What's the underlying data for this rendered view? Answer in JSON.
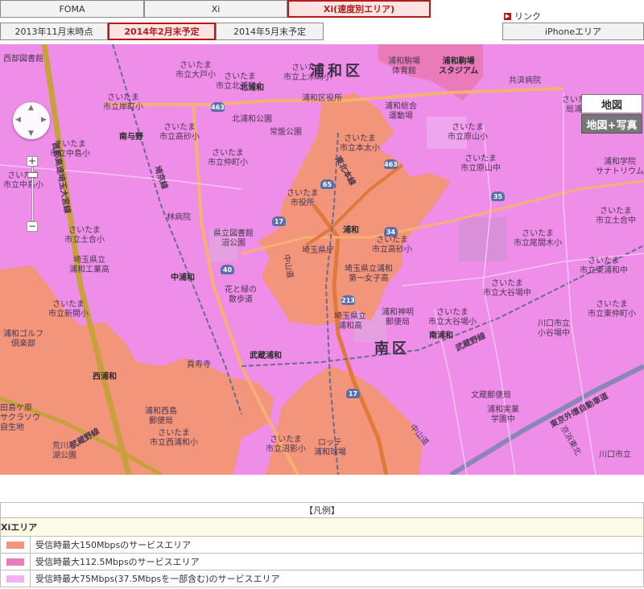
{
  "tabs": {
    "network": [
      {
        "label": "FOMA",
        "active": false
      },
      {
        "label": "Xi",
        "active": false
      },
      {
        "label": "Xi(速度別エリア)",
        "active": true
      }
    ],
    "period": [
      {
        "label": "2013年11月末時点",
        "active": false
      },
      {
        "label": "2014年2月末予定",
        "active": true
      },
      {
        "label": "2014年5月末予定",
        "active": false
      }
    ]
  },
  "links": {
    "label": "リンク",
    "iphone": "iPhoneエリア"
  },
  "map_controls": {
    "type_map": "地図",
    "type_photo": "地図+写真",
    "zoom_in": "+",
    "zoom_out": "−"
  },
  "map": {
    "wards": {
      "urawa": "浦和区",
      "minami": "南区"
    },
    "labels": {
      "l01": "西部図書館",
      "l02": "さいたま\n市立大戸小",
      "l03": "さいたま\n市立岸町小",
      "l04": "さいたま\n市立高砂小",
      "l05": "さいたま\n市立仲町小",
      "l06": "さいたま\n市立北浦和小",
      "l07": "北浦和公園",
      "l08": "常盤公園",
      "l09": "さいたま\n市立中島小",
      "l10": "さいたま\n市立上木崎小",
      "l11": "浦和駒場\n体育館",
      "l12": "共済病院",
      "l13": "浦和総合\n運動場",
      "l14": "浦和区役所",
      "l15": "さいたま\n市立本太小",
      "l16": "さいたま\n市立原山小",
      "l17": "さいたま\n市立原山中",
      "l18": "さいたま市消防\n局浦和消防署",
      "l19": "浦和学院\nサナトリウム",
      "l20": "林病院",
      "l21": "さいたま\n市役所",
      "l22": "県立図書館\n沼公園",
      "l23": "埼玉県庁",
      "l24": "さいたま\n市立土合小",
      "l25": "埼玉県立\n浦和工業高",
      "l26": "埼玉県立浦和\n第一女子高",
      "l27": "さいたま\n市立高砂小",
      "l28": "さいたま\n市立中島小",
      "l29": "花と緑の\n散歩道",
      "l30": "さいたま\n市立新開小",
      "l31": "浦和ゴルフ\n倶楽部",
      "l32": "さいたま\n市立西浦和小",
      "l33": "浦和西島\n郵便局",
      "l34": "貢寿寺",
      "l35": "さいたま\n市立沼影小",
      "l36": "浦和神明\n郵便局",
      "l37": "埼玉県立\n浦和高",
      "l38": "さいたま\n市立大谷場中",
      "l39": "さいたま\n市立大谷場小",
      "l40": "さいたま\n市立東浦和中",
      "l41": "さいたま\n市立尾間木小",
      "l42": "文蔵郵便局",
      "l43": "浦和実業\n学園中",
      "l44": "川口市立\n小谷場中",
      "l45": "ロッテ\n浦和球場",
      "l46": "田島ケ原\nサクラソウ\n自生地",
      "l47": "荒川彩\n湖公園",
      "l48": "さいたま\n市立土合中",
      "l49": "さいたま\n市立東仲町小",
      "l50": "川口市立"
    },
    "stations": {
      "s1": "北浦和",
      "s2": "南与野",
      "s3": "浦和",
      "s4": "中浦和",
      "s5": "南浦和",
      "s6": "武蔵浦和",
      "s7": "西浦和",
      "s8": "浦和駒場\nスタジアム"
    },
    "railways": {
      "r1": "東北本線",
      "r2": "埼京線",
      "r3": "武蔵野線",
      "r4": "武蔵野線",
      "r5": "首都高速埼玉大宮線",
      "r6": "東京外環自動車道",
      "r7": "中山道",
      "r8": "中山道",
      "r9": "京浜東北"
    },
    "routes": [
      "463",
      "65",
      "17",
      "34",
      "40",
      "213",
      "35",
      "17",
      "463"
    ]
  },
  "legend": {
    "title": "【凡例】",
    "section": "Xiエリア",
    "items": [
      {
        "label": "受信時最大150Mbpsのサービスエリア",
        "color": "#f2957a"
      },
      {
        "label": "受信時最大112.5Mbpsのサービスエリア",
        "color": "#ea7aba"
      },
      {
        "label": "受信時最大75Mbps(37.5Mbpsを一部含む)のサービスエリア",
        "color": "#f2b2f0"
      }
    ]
  },
  "colors": {
    "area_150": "#f2957a",
    "area_112": "#ea7aba",
    "area_75": "#ee8ee8",
    "accent": "#b31b1b"
  }
}
